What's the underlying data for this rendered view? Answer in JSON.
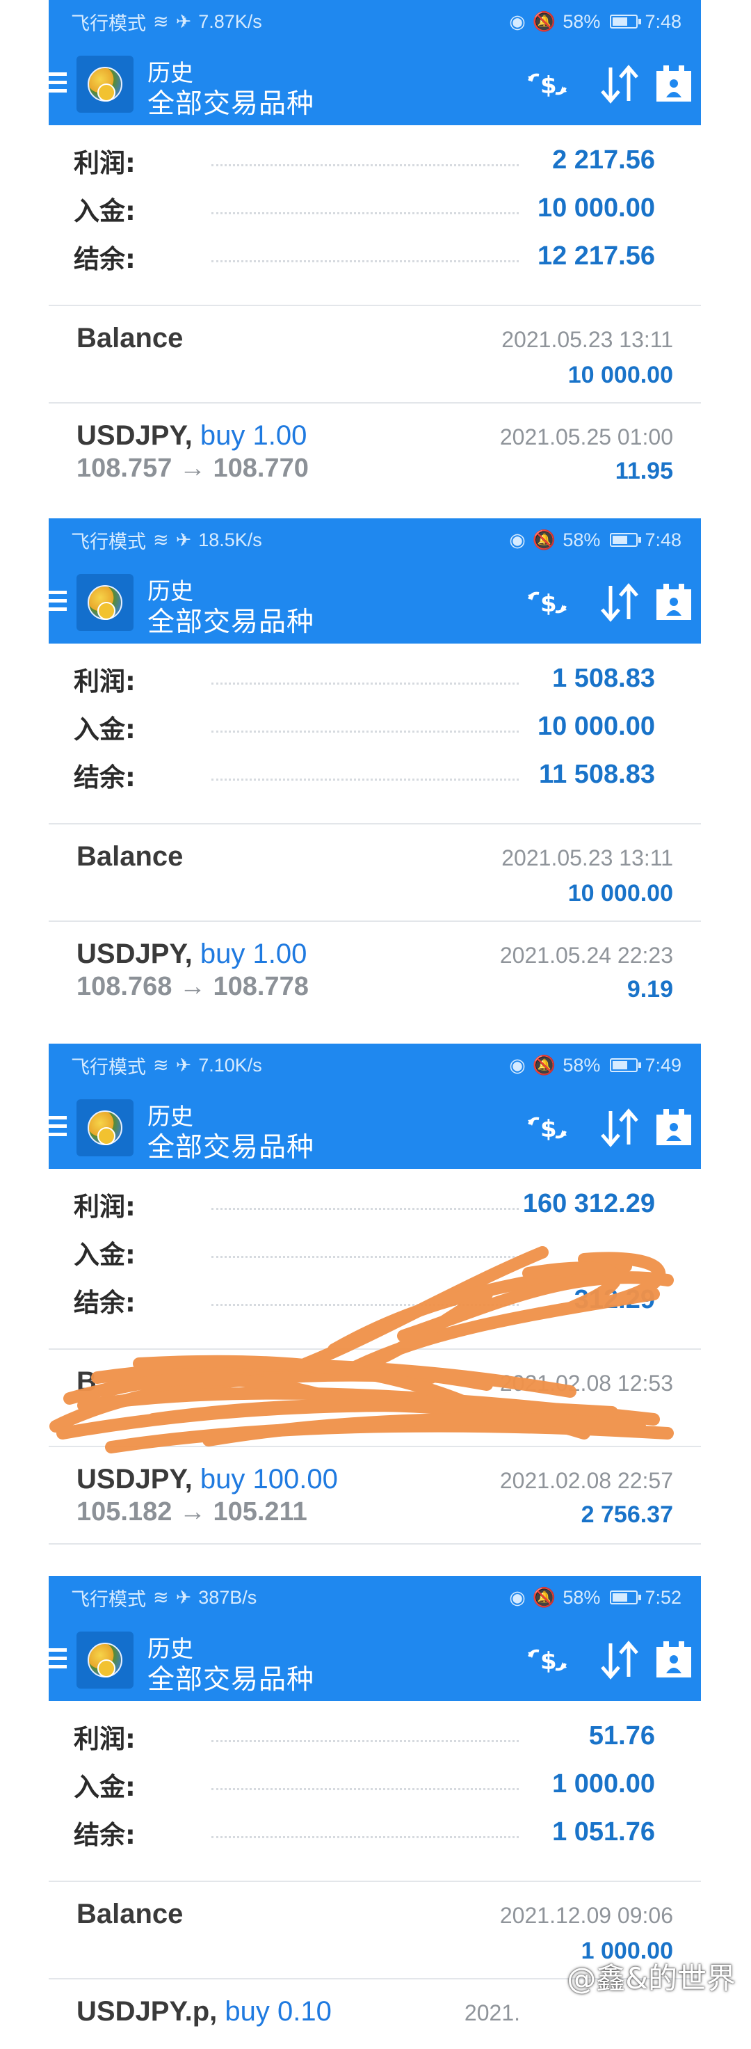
{
  "screens": [
    {
      "status": {
        "left": "飞行模式",
        "speed": "7.87K/s",
        "battery": "58%",
        "time": "7:48"
      },
      "toolbar": {
        "title": "历史",
        "subtitle": "全部交易品种"
      },
      "summary": [
        {
          "label": "利润:",
          "value": "2 217.56"
        },
        {
          "label": "入金:",
          "value": "10 000.00"
        },
        {
          "label": "结余:",
          "value": "12 217.56"
        }
      ],
      "balance": {
        "title": "Balance",
        "date": "2021.05.23 13:11",
        "amount": "10 000.00"
      },
      "trade": {
        "symbol": "USDJPY,",
        "action": "buy 1.00",
        "prices": "108.757 → 108.770",
        "date": "2021.05.25 01:00",
        "amount": "11.95"
      }
    },
    {
      "status": {
        "left": "飞行模式",
        "speed": "18.5K/s",
        "battery": "58%",
        "time": "7:48"
      },
      "toolbar": {
        "title": "历史",
        "subtitle": "全部交易品种"
      },
      "summary": [
        {
          "label": "利润:",
          "value": "1 508.83"
        },
        {
          "label": "入金:",
          "value": "10 000.00"
        },
        {
          "label": "结余:",
          "value": "11 508.83"
        }
      ],
      "balance": {
        "title": "Balance",
        "date": "2021.05.23 13:11",
        "amount": "10 000.00"
      },
      "trade": {
        "symbol": "USDJPY,",
        "action": "buy 1.00",
        "prices": "108.768 → 108.778",
        "date": "2021.05.24 22:23",
        "amount": "9.19"
      }
    },
    {
      "status": {
        "left": "飞行模式",
        "speed": "7.10K/s",
        "battery": "58%",
        "time": "7:49"
      },
      "toolbar": {
        "title": "历史",
        "subtitle": "全部交易品种"
      },
      "summary": [
        {
          "label": "利润:",
          "value": "160 312.29"
        },
        {
          "label": "入金:",
          "value": ""
        },
        {
          "label": "结余:",
          "value": "312.29"
        }
      ],
      "balance": {
        "title": "B",
        "date": "2021.02.08 12:53",
        "amount": ""
      },
      "trade": {
        "symbol": "USDJPY,",
        "action": "buy 100.00",
        "prices": "105.182 → 105.211",
        "date": "2021.02.08 22:57",
        "amount": "2 756.37"
      }
    },
    {
      "status": {
        "left": "飞行模式",
        "speed": "387B/s",
        "battery": "58%",
        "time": "7:52"
      },
      "toolbar": {
        "title": "历史",
        "subtitle": "全部交易品种"
      },
      "summary": [
        {
          "label": "利润:",
          "value": "51.76"
        },
        {
          "label": "入金:",
          "value": "1 000.00"
        },
        {
          "label": "结余:",
          "value": "1 051.76"
        }
      ],
      "balance": {
        "title": "Balance",
        "date": "2021.12.09 09:06",
        "amount": "1 000.00"
      },
      "trade": {
        "symbol": "USDJPY.p,",
        "action": "buy 0.10",
        "prices": "",
        "date": "2021.",
        "amount": ""
      }
    }
  ],
  "watermark": "@鑫&的世界",
  "colors": {
    "toolbar": "#1f88ef",
    "value_blue": "#1973c9",
    "scribble": "#f0924a"
  }
}
